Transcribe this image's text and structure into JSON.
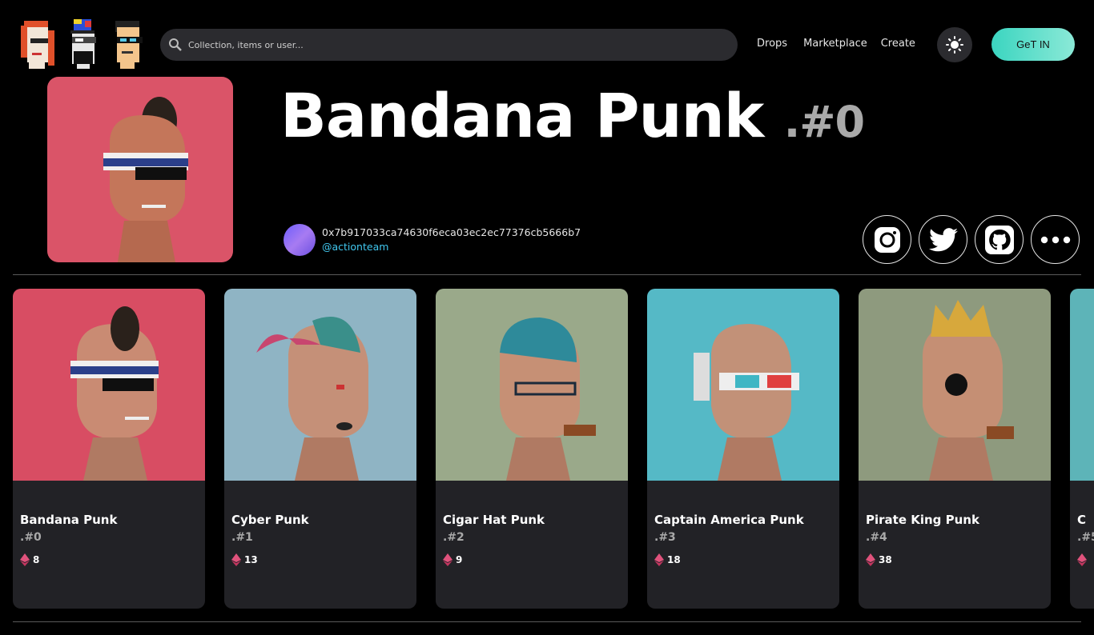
{
  "search": {
    "placeholder": "Collection, items or user..."
  },
  "nav": {
    "drops": "Drops",
    "marketplace": "Marketplace",
    "create": "Create"
  },
  "header": {
    "cta": "GeT IN"
  },
  "hero": {
    "name": "Bandana Punk",
    "id": ".#0",
    "owner_address": "0x7b917033ca74630f6eca03ec2ec77376cb5666b7",
    "owner_handle": "@actionteam"
  },
  "colors": {
    "accent": "#41c8f0",
    "cta_start": "#3bd5c0",
    "cta_end": "#8be9d7",
    "card_bg": "#222226",
    "eth_pink": "#e0527c"
  },
  "cards": [
    {
      "name": "Bandana Punk",
      "id": ".#0",
      "price": "8",
      "bg": "#d84d63"
    },
    {
      "name": "Cyber Punk",
      "id": ".#1",
      "price": "13",
      "bg": "#8fb4c4"
    },
    {
      "name": "Cigar Hat Punk",
      "id": ".#2",
      "price": "9",
      "bg": "#9aa98a"
    },
    {
      "name": "Captain America Punk",
      "id": ".#3",
      "price": "18",
      "bg": "#55b9c6"
    },
    {
      "name": "Pirate King Punk",
      "id": ".#4",
      "price": "38",
      "bg": "#8e9a7e"
    },
    {
      "name": "C",
      "id": ".#5",
      "price": "",
      "bg": "#5db4b8"
    }
  ]
}
